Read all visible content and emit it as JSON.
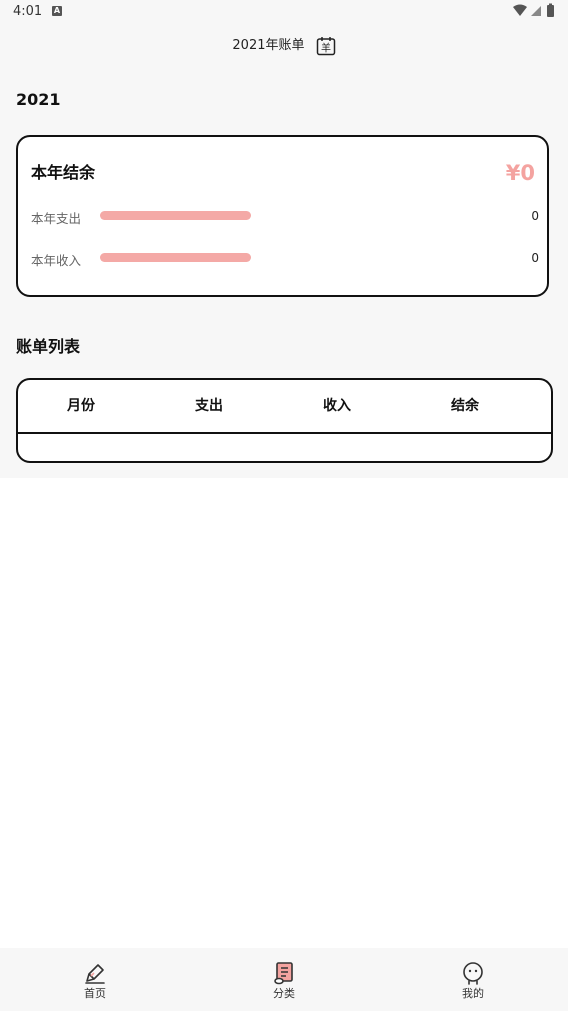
{
  "status_bar": {
    "time": "4:01",
    "notification_icon": "a-icon"
  },
  "header": {
    "title": "2021年账单",
    "calendar_icon_char": "羊"
  },
  "year": "2021",
  "summary": {
    "title": "本年结余",
    "amount": "¥0",
    "expense": {
      "label": "本年支出",
      "value": "0"
    },
    "income": {
      "label": "本年收入",
      "value": "0"
    }
  },
  "list": {
    "title": "账单列表",
    "columns": [
      "月份",
      "支出",
      "收入",
      "结余"
    ],
    "rows": []
  },
  "nav": {
    "home_label": "首页",
    "category_label": "分类",
    "profile_label": "我的"
  },
  "colors": {
    "accent": "#f4a3a0",
    "background": "#f7f7f7"
  }
}
